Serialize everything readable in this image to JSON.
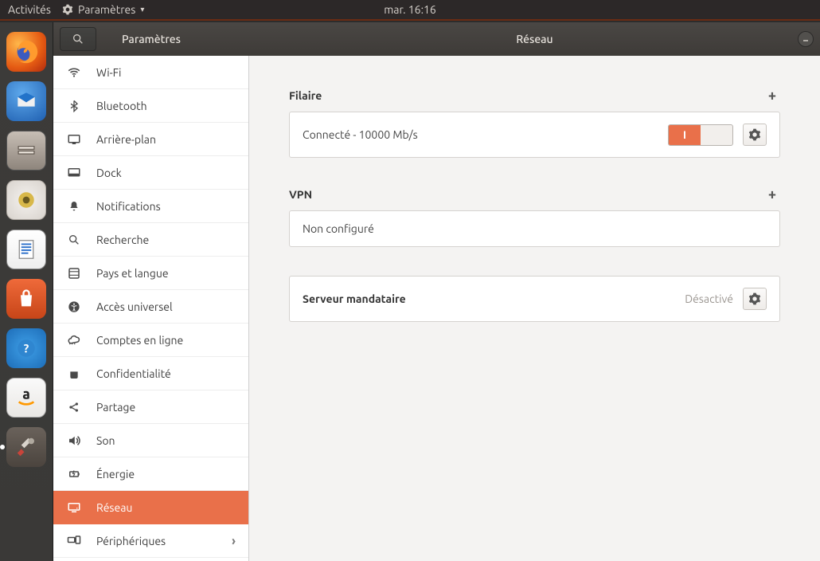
{
  "topbar": {
    "activities": "Activités",
    "app_menu": "Paramètres",
    "clock": "mar. 16:16"
  },
  "launcher": {
    "items": [
      {
        "name": "firefox"
      },
      {
        "name": "thunderbird"
      },
      {
        "name": "files"
      },
      {
        "name": "rhythmbox"
      },
      {
        "name": "libreoffice-writer"
      },
      {
        "name": "ubuntu-software"
      },
      {
        "name": "help"
      },
      {
        "name": "amazon"
      },
      {
        "name": "settings"
      }
    ]
  },
  "window": {
    "sidebar_title": "Paramètres",
    "main_title": "Réseau"
  },
  "sidebar": {
    "items": [
      {
        "label": "Wi-Fi",
        "icon": "wifi"
      },
      {
        "label": "Bluetooth",
        "icon": "bluetooth"
      },
      {
        "label": "Arrière-plan",
        "icon": "background"
      },
      {
        "label": "Dock",
        "icon": "dock"
      },
      {
        "label": "Notifications",
        "icon": "bell"
      },
      {
        "label": "Recherche",
        "icon": "search"
      },
      {
        "label": "Pays et langue",
        "icon": "globe"
      },
      {
        "label": "Accès universel",
        "icon": "accessibility"
      },
      {
        "label": "Comptes en ligne",
        "icon": "cloud"
      },
      {
        "label": "Confidentialité",
        "icon": "privacy"
      },
      {
        "label": "Partage",
        "icon": "share"
      },
      {
        "label": "Son",
        "icon": "sound"
      },
      {
        "label": "Énergie",
        "icon": "power"
      },
      {
        "label": "Réseau",
        "icon": "network",
        "selected": true
      },
      {
        "label": "Périphériques",
        "icon": "devices",
        "chevron": true
      }
    ]
  },
  "network": {
    "wired": {
      "title": "Filaire",
      "status": "Connecté - 10000 Mb/s",
      "toggle_on_label": "I"
    },
    "vpn": {
      "title": "VPN",
      "status": "Non configuré"
    },
    "proxy": {
      "title": "Serveur mandataire",
      "status": "Désactivé"
    }
  }
}
